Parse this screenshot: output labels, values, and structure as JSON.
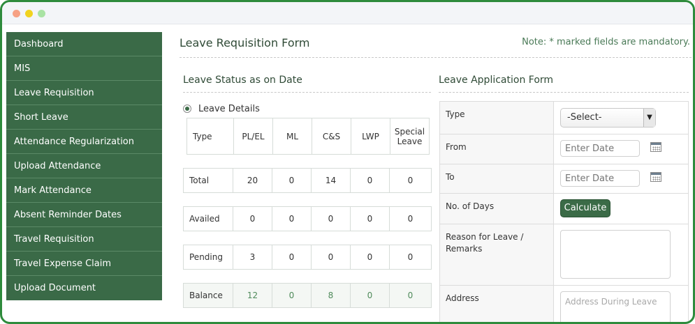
{
  "sidebar": {
    "items": [
      {
        "label": "Dashboard"
      },
      {
        "label": "MIS"
      },
      {
        "label": "Leave Requisition"
      },
      {
        "label": "Short Leave"
      },
      {
        "label": "Attendance Regularization"
      },
      {
        "label": "Upload Attendance"
      },
      {
        "label": "Mark Attendance"
      },
      {
        "label": "Absent Reminder Dates"
      },
      {
        "label": "Travel Requisition"
      },
      {
        "label": "Travel Expense Claim"
      },
      {
        "label": "Upload Document"
      }
    ]
  },
  "page": {
    "title": "Leave Requisition Form",
    "note": "Note: * marked fields are mandatory."
  },
  "leave_status": {
    "title": "Leave Status as on Date",
    "option_label": "Leave Details",
    "headers": [
      "Type",
      "PL/EL",
      "ML",
      "C&S",
      "LWP",
      "Special Leave"
    ],
    "rows": [
      {
        "label": "Total",
        "values": [
          "20",
          "0",
          "14",
          "0",
          "0"
        ]
      },
      {
        "label": "Availed",
        "values": [
          "0",
          "0",
          "0",
          "0",
          "0"
        ]
      },
      {
        "label": "Pending",
        "values": [
          "3",
          "0",
          "0",
          "0",
          "0"
        ]
      },
      {
        "label": "Balance",
        "values": [
          "12",
          "0",
          "8",
          "0",
          "0"
        ]
      }
    ]
  },
  "application_form": {
    "title": "Leave Application Form",
    "type_label": "Type",
    "type_selected": "-Select-",
    "from_label": "From",
    "from_placeholder": "Enter Date",
    "to_label": "To",
    "to_placeholder": "Enter Date",
    "days_label": "No. of Days",
    "calculate_label": "Calculate",
    "reason_label": "Reason for Leave / Remarks",
    "address_label": "Address",
    "address_placeholder": "Address During Leave"
  },
  "colors": {
    "sidebar_bg": "#3a6a47",
    "accent": "#3b6b47",
    "frame_border": "#2e8b3c",
    "balance_text": "#4e8a5a"
  },
  "icons": [
    "calendar-icon",
    "chevron-down-icon",
    "radio-selected-icon"
  ]
}
